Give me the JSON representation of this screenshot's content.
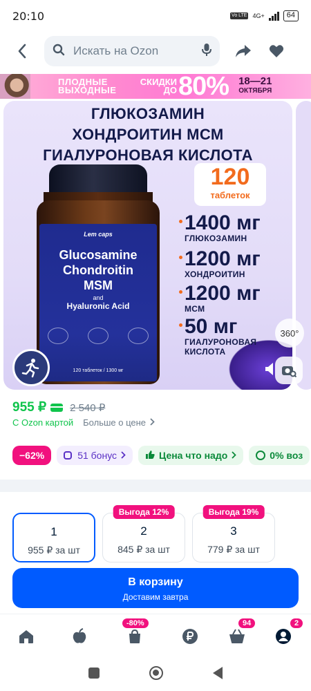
{
  "status_bar": {
    "time": "20:10",
    "network": "4G+",
    "volte": "Vo LTE",
    "battery": "64"
  },
  "search": {
    "placeholder": "Искать на Ozon"
  },
  "promo": {
    "line1a": "ПЛОДНЫЕ",
    "line1b": "ВЫХОДНЫЕ",
    "line2a": "СКИДКИ",
    "line2b": "ДО",
    "big": "80%",
    "date": "18—21",
    "month": "ОКТЯБРЯ"
  },
  "product_image": {
    "title_lines": [
      "ГЛЮКОЗАМИН",
      "ХОНДРОИТИН МСМ",
      "ГИАЛУРОНОВАЯ КИСЛОТА"
    ],
    "count": "120",
    "count_label": "таблеток",
    "jar": {
      "brand": "Lem caps",
      "l1": "Glucosamine",
      "l2": "Chondroitin",
      "l3": "MSM",
      "and": "and",
      "l4": "Hyaluronic Acid",
      "foot": "120 таблеток / 1300 мг"
    },
    "doses": [
      {
        "value": "1400 мг",
        "name": "ГЛЮКОЗАМИН"
      },
      {
        "value": "1200 мг",
        "name": "ХОНДРОИТИН"
      },
      {
        "value": "1200 мг",
        "name": "МСМ"
      },
      {
        "value": "50 мг",
        "name": "ГИАЛУРОНОВАЯ"
      }
    ],
    "dose_extra": "КИСЛОТА",
    "badge_360": "360°"
  },
  "price": {
    "current": "955 ₽",
    "old": "2 540 ₽",
    "ozon_card_label": "С Ozon картой",
    "more_label": "Больше о цене"
  },
  "chips": {
    "discount": "−62%",
    "bonus": "51 бонус",
    "fair_price": "Цена что надо",
    "cashback": "0% воз"
  },
  "quantity_options": [
    {
      "qty": "1",
      "price": "955 ₽ за шт",
      "tag": ""
    },
    {
      "qty": "2",
      "price": "845 ₽ за шт",
      "tag": "Выгода 12%"
    },
    {
      "qty": "3",
      "price": "779 ₽ за шт",
      "tag": "Выгода 19%"
    }
  ],
  "cart": {
    "title": "В корзину",
    "subtitle": "Доставим завтра"
  },
  "bottom_nav": {
    "promo_badge": "-80%",
    "cart_badge": "94",
    "profile_badge": "2"
  },
  "colors": {
    "accent": "#005bff",
    "price_green": "#10c44c",
    "badge_pink": "#f1117e"
  }
}
